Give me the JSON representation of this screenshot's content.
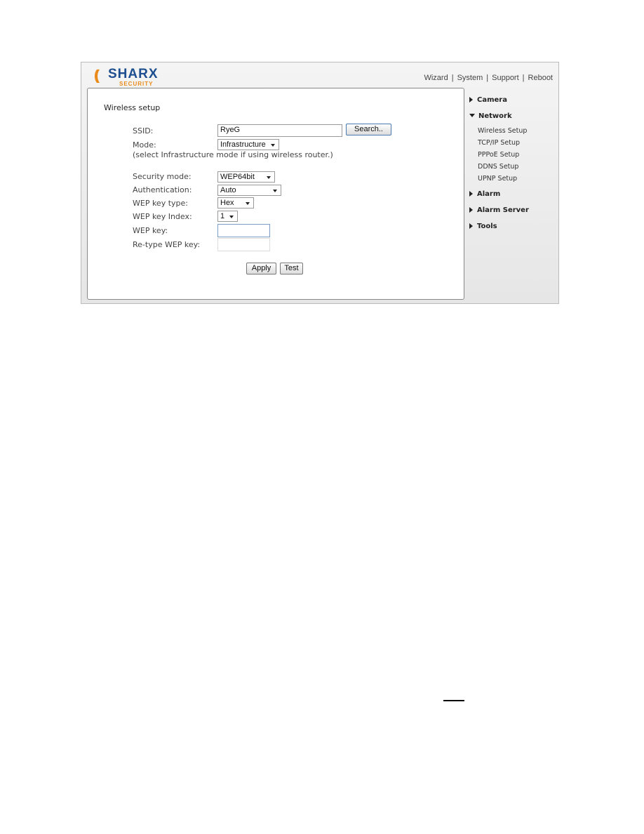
{
  "header": {
    "logo_text": "SHARX",
    "logo_sub": "SECURITY",
    "links": [
      "Wizard",
      "System",
      "Support",
      "Reboot"
    ]
  },
  "form": {
    "title": "Wireless setup",
    "ssid_label": "SSID:",
    "ssid_value": "RyeG",
    "search_button": "Search..",
    "mode_label": "Mode:",
    "mode_value": "Infrastructure",
    "mode_hint": "(select Infrastructure mode if using wireless router.)",
    "security_label": "Security mode:",
    "security_value": "WEP64bit",
    "auth_label": "Authentication:",
    "auth_value": "Auto",
    "key_type_label": "WEP key type:",
    "key_type_value": "Hex",
    "key_index_label": "WEP key Index:",
    "key_index_value": "1",
    "key_label": "WEP key:",
    "key_value": "",
    "retype_label": "Re-type WEP key:",
    "retype_value": "",
    "apply_button": "Apply",
    "test_button": "Test"
  },
  "sidebar": {
    "camera": "Camera",
    "network": "Network",
    "network_items": [
      "Wireless Setup",
      "TCP/IP Setup",
      "PPPoE Setup",
      "DDNS Setup",
      "UPNP Setup"
    ],
    "alarm": "Alarm",
    "alarm_server": "Alarm Server",
    "tools": "Tools"
  }
}
